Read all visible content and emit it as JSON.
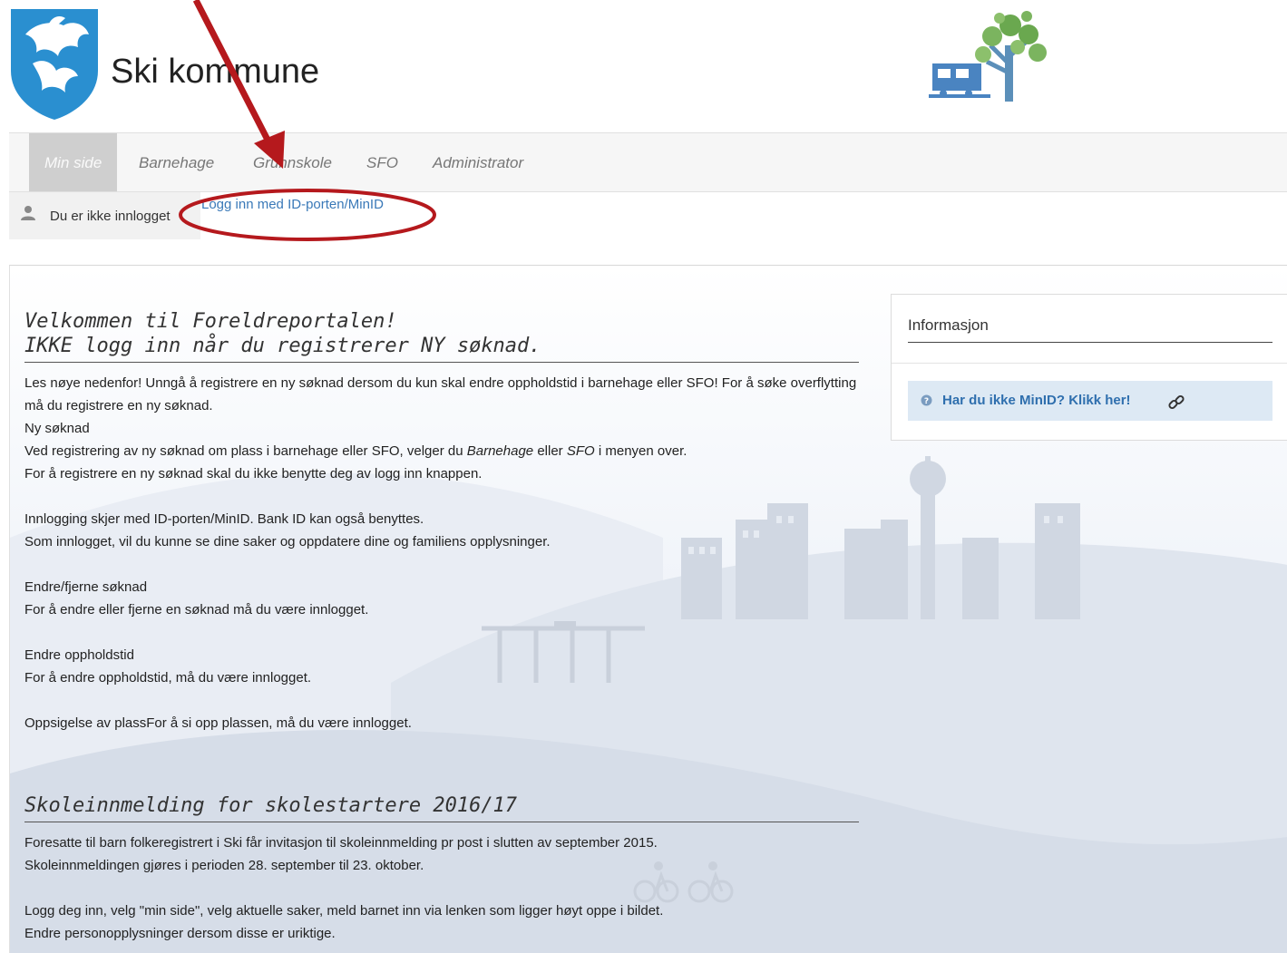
{
  "header": {
    "site_name": "Ski kommune"
  },
  "nav": {
    "items": [
      {
        "label": "Min side",
        "active": true
      },
      {
        "label": "Barnehage",
        "active": false
      },
      {
        "label": "Grunnskole",
        "active": false
      },
      {
        "label": "SFO",
        "active": false
      },
      {
        "label": "Administrator",
        "active": false
      }
    ]
  },
  "login": {
    "status": "Du er ikke innlogget",
    "link": "Logg inn med ID-porten/MinID"
  },
  "main": {
    "welcome": {
      "title_line1": "Velkommen til Foreldreportalen!",
      "title_line2": "IKKE logg inn når du registrerer NY søknad.",
      "p1": "Les nøye nedenfor! Unngå å registrere en ny søknad dersom du kun skal endre oppholdstid i barnehage eller SFO! For å søke overflytting må du registrere en ny søknad.",
      "ny_soknad_heading": "Ny søknad",
      "ny_soknad_text_a": "Ved registrering av ny søknad om plass i barnehage eller SFO, velger du ",
      "ny_soknad_em1": "Barnehage",
      "ny_soknad_text_b": " eller ",
      "ny_soknad_em2": "SFO",
      "ny_soknad_text_c": " i menyen over.",
      "ny_soknad_line2": "For å registrere en ny søknad skal du ikke benytte deg av logg inn knappen.",
      "login_info1": "Innlogging skjer med ID-porten/MinID. Bank ID kan også benyttes.",
      "login_info2": "Som innlogget, vil du kunne se dine saker og oppdatere dine og familiens opplysninger.",
      "endre_heading": "Endre/fjerne søknad",
      "endre_text": "For å endre eller fjerne en søknad må du være innlogget.",
      "opphold_heading": "Endre oppholdstid",
      "opphold_text": "For å endre oppholdstid, må du være innlogget.",
      "oppsigelse": "Oppsigelse av plassFor å si opp plassen, må du være innlogget."
    },
    "skole": {
      "title": "Skoleinnmelding for skolestartere 2016/17",
      "p1": "Foresatte til barn folkeregistrert i Ski får invitasjon til skoleinnmelding pr post i slutten av september 2015.",
      "p2": "Skoleinnmeldingen gjøres i perioden 28. september til 23. oktober.",
      "p3": "Logg deg inn, velg \"min side\", velg aktuelle saker, meld barnet inn via lenken som ligger høyt oppe i bildet.",
      "p4": "Endre personopplysninger dersom disse er uriktige."
    }
  },
  "info": {
    "title": "Informasjon",
    "link": "Har du ikke MinID? Klikk her!"
  },
  "colors": {
    "link": "#3a79b8",
    "annotation": "#b5191d",
    "crest": "#2a8fd0",
    "tree": "#6aa84f"
  },
  "icons": {
    "user": "user-icon",
    "question": "question-circle-icon",
    "chain": "link-chain-icon"
  }
}
